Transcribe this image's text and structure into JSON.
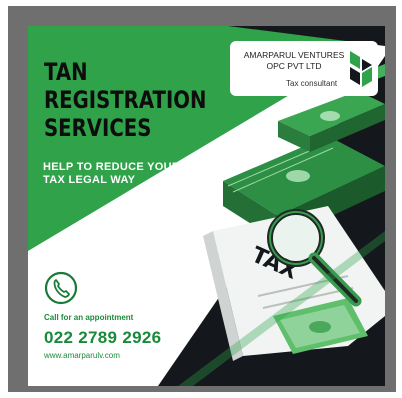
{
  "headline": [
    "TAN",
    "REGISTRATION",
    "SERVICES"
  ],
  "subheadline": [
    "HELP TO REDUCE YOUR",
    "TAX LEGAL WAY"
  ],
  "company": {
    "name": "AMARPARUL VENTURES\nOPC PVT LTD",
    "role": "Tax consultant"
  },
  "illustration": {
    "paper_text": "TAX"
  },
  "contact": {
    "cta": "Call for an appointment",
    "phone": "022 2789 2926",
    "website": "www.amarparulv.com"
  },
  "colors": {
    "green": "#2fa24a",
    "dark": "#14171c",
    "accent_text": "#1a8a3a"
  },
  "icons": [
    "phone-icon",
    "logo-mark-icon",
    "magnifier-icon",
    "money-stack-icon"
  ]
}
